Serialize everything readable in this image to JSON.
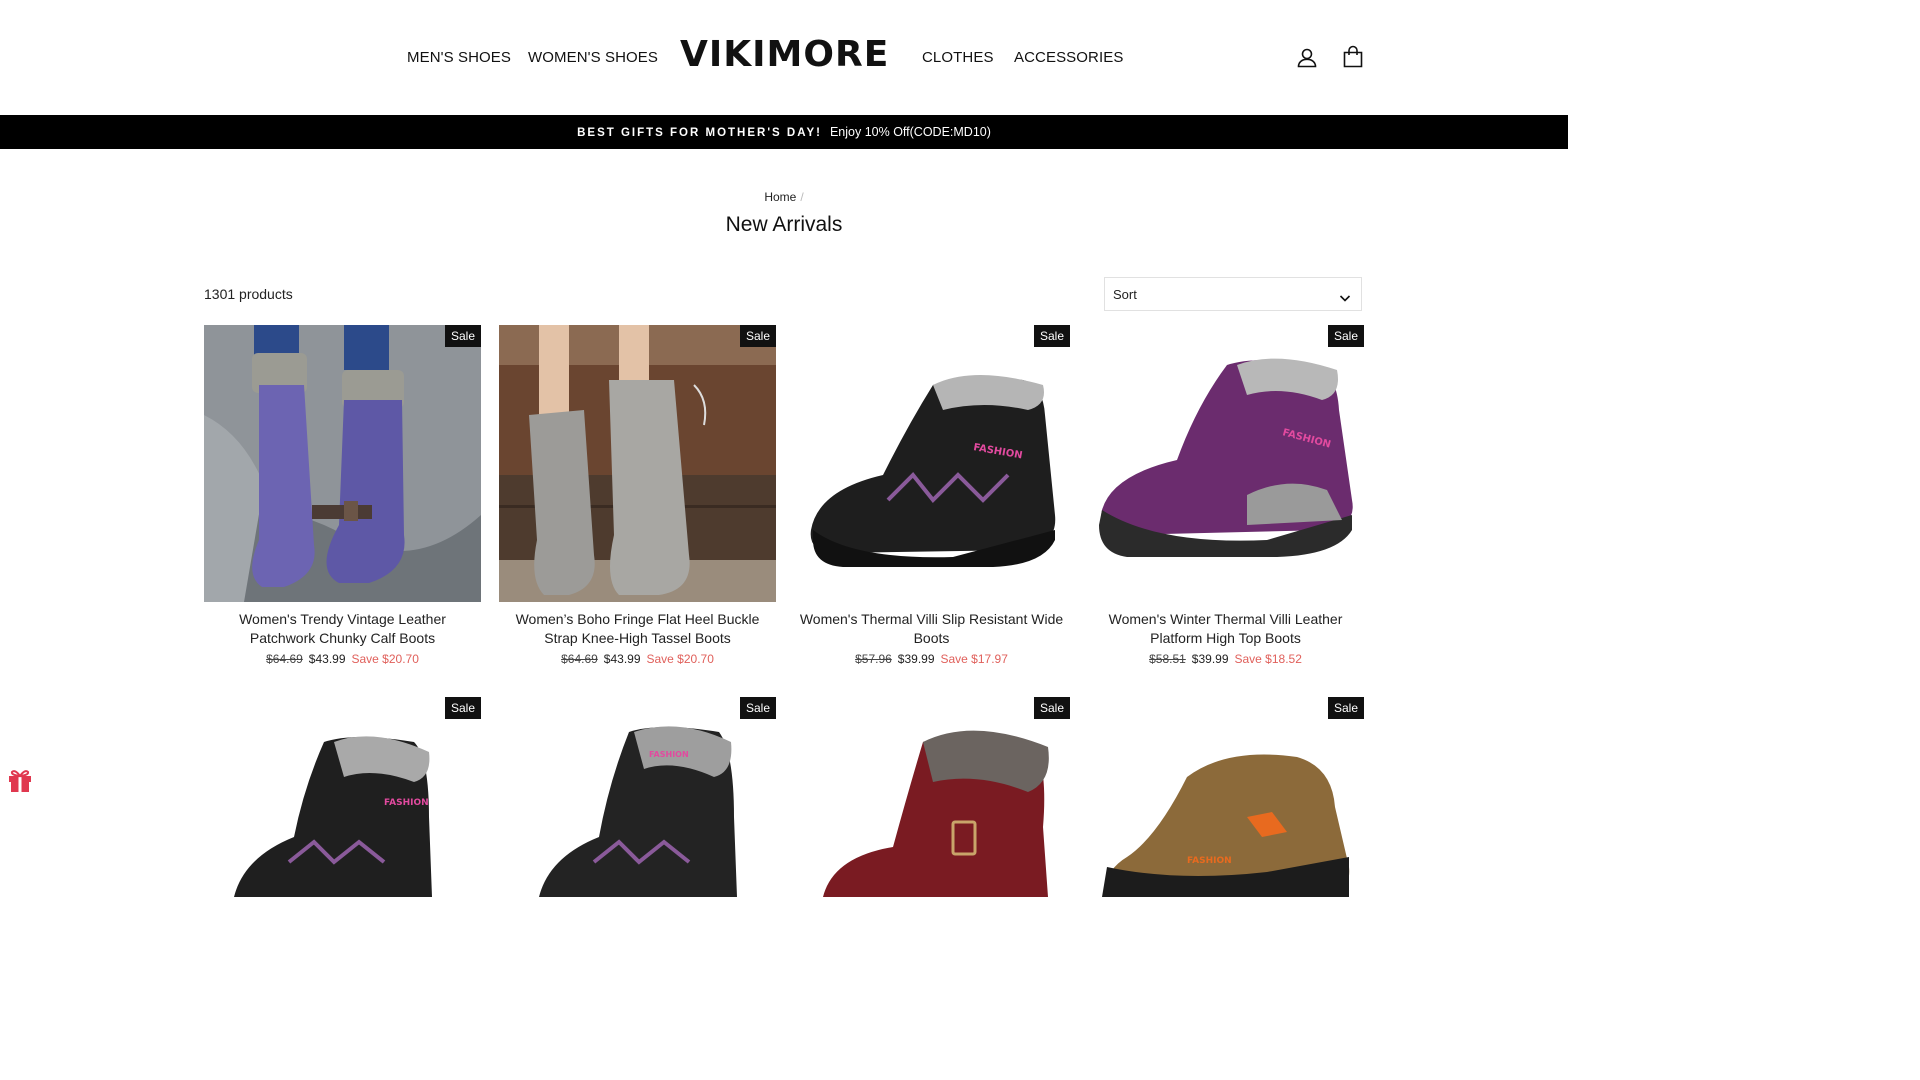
{
  "header": {
    "nav_left": [
      "MEN'S SHOES",
      "WOMEN'S SHOES"
    ],
    "logo": "VIKIMORE",
    "nav_right": [
      "CLOTHES",
      "ACCESSORIES"
    ],
    "icons": [
      "account-icon",
      "cart-icon"
    ]
  },
  "announcement": {
    "strong": "BEST GIFTS FOR MOTHER'S DAY!",
    "text": "Enjoy 10% Off(CODE:MD10)"
  },
  "breadcrumb": {
    "home": "Home",
    "separator": "/"
  },
  "page_title": "New Arrivals",
  "product_count": "1301 products",
  "sort": {
    "label": "Sort"
  },
  "products": [
    {
      "badge": "Sale",
      "title": "Women's Trendy Vintage Leather Patchwork Chunky Calf Boots",
      "old_price": "$64.69",
      "price": "$43.99",
      "save": "Save $20.70",
      "image": "purple-calf-boots-photo"
    },
    {
      "badge": "Sale",
      "title": "Women’s Boho Fringe Flat Heel Buckle Strap Knee-High Tassel Boots",
      "old_price": "$64.69",
      "price": "$43.99",
      "save": "Save $20.70",
      "image": "grey-knee-high-boots-photo"
    },
    {
      "badge": "Sale",
      "title": "Women's Thermal Villi Slip Resistant Wide Boots",
      "old_price": "$57.96",
      "price": "$39.99",
      "save": "Save $17.97",
      "image": "black-ankle-boot-photo"
    },
    {
      "badge": "Sale",
      "title": "Women's Winter Thermal Villi Leather Platform High Top Boots",
      "old_price": "$58.51",
      "price": "$39.99",
      "save": "Save $18.52",
      "image": "purple-high-top-boot-photo"
    },
    {
      "badge": "Sale",
      "image": "black-high-boot-photo"
    },
    {
      "badge": "Sale",
      "image": "black-fur-boot-photo"
    },
    {
      "badge": "Sale",
      "image": "burgundy-fur-boot-photo"
    },
    {
      "badge": "Sale",
      "image": "brown-hiking-shoe-photo"
    }
  ],
  "gift_icon": "gift-icon"
}
